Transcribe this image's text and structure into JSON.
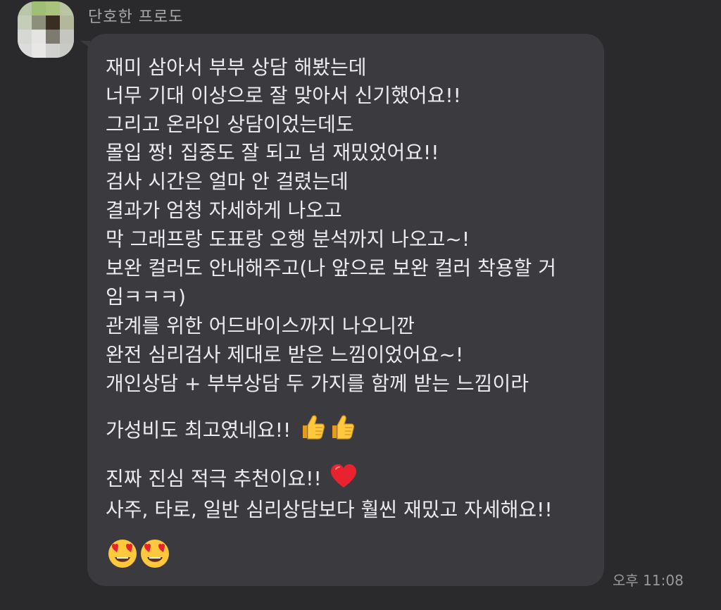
{
  "chat": {
    "sender": "단호한 프로도",
    "time": "오후 11:08",
    "avatar_icon": "pixelated-profile-avatar",
    "colors": {
      "background": "#2a2a2c",
      "bubble": "#3b3b3f",
      "text": "#ececee",
      "sender": "#a9a9ad",
      "time": "#9a9a9e"
    },
    "lines": [
      "재미 삼아서 부부 상담 해봤는데",
      "너무 기대 이상으로 잘 맞아서 신기했어요!!",
      "그리고 온라인 상담이었는데도",
      "몰입 짱! 집중도 잘 되고 넘 재밌었어요!!",
      "검사 시간은 얼마 안 걸렸는데",
      "결과가 엄청 자세하게 나오고",
      "막 그래프랑 도표랑 오행 분석까지 나오고~!",
      "보완 컬러도 안내해주고(나 앞으로 보완 컬러 착용할 거",
      "임ㅋㅋㅋ)",
      "관계를 위한 어드바이스까지 나오니깐",
      "완전 심리검사 제대로 받은 느낌이었어요~!",
      "개인상담 + 부부상담 두 가지를 함께 받는 느낌이라",
      "가성비도 최고였네요!!",
      "진짜 진심 적극 추천이요!!",
      "사주, 타로, 일반 심리상담보다 훨씬 재밌고 자세해요!!"
    ],
    "emojis": {
      "line13": [
        "thumbs-up-icon",
        "thumbs-up-icon"
      ],
      "line14": [
        "red-heart-icon"
      ],
      "line16": [
        "heart-eyes-face-icon",
        "heart-eyes-face-icon"
      ]
    }
  }
}
